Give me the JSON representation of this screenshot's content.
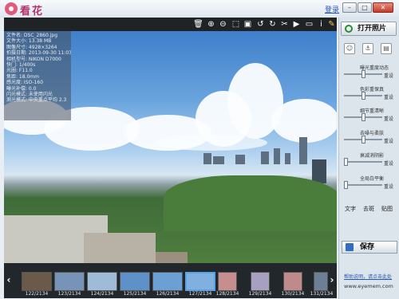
{
  "app": {
    "title": "看花",
    "login": "登录"
  },
  "window": {
    "min_icon": "minimize-icon",
    "max_icon": "maximize-icon",
    "close_icon": "close-icon"
  },
  "info": [
    "文件名: DSC_2860.jpg",
    "文件大小: 13.38 MB",
    "图像尺寸: 4928×3264",
    "拍摄日期: 2013-09-30 11:03:00",
    "相机型号: NIKON D7000",
    "快门: 1/400s",
    "光圈: F11.0",
    "焦距: 18.0mm",
    "感光度: ISO-160",
    "曝光补偿: 0.0",
    "闪光模式: 未使用闪光",
    "测光模式: 中央重点平均 2.3"
  ],
  "thumbnails": [
    {
      "label": "122/2134",
      "color": "#6b5a4a"
    },
    {
      "label": "123/2134",
      "color": "#7793b8"
    },
    {
      "label": "124/2134",
      "color": "#9ebcd8"
    },
    {
      "label": "125/2134",
      "color": "#5f91c9"
    },
    {
      "label": "126/2134",
      "color": "#6c9fd4"
    },
    {
      "label": "127/2134",
      "color": "#7fb0e0"
    },
    {
      "label": "128/2134",
      "color": "#c78e8e"
    },
    {
      "label": "129/2134",
      "color": "#a8a0c0"
    },
    {
      "label": "130/2134",
      "color": "#c08a8a"
    },
    {
      "label": "131/2134",
      "color": "#6c7f94"
    }
  ],
  "panel": {
    "open_label": "打开照片",
    "sliders": [
      {
        "label": "曝光重度动态",
        "reset": "重设",
        "value": 0.5
      },
      {
        "label": "色彩重保真",
        "reset": "重设",
        "value": 0.5
      },
      {
        "label": "细节重清晰",
        "reset": "重设",
        "value": 0.5
      },
      {
        "label": "去噪与柔肤",
        "reset": "重设",
        "value": 0.5
      },
      {
        "label": "衰减消阴影",
        "reset": "重设",
        "value": 0.0
      },
      {
        "label": "全局白平衡",
        "reset": "重设",
        "value": 0.0
      }
    ],
    "tabs": [
      "文字",
      "去斑",
      "贴图"
    ],
    "save_label": "保存",
    "help_link": "帮助说明，请点击此处",
    "url": "www.eyemem.com"
  },
  "colors": {
    "accent": "#b3326a",
    "link": "#2556b8",
    "toolbar": "#202326",
    "panel": "#dce5ec"
  }
}
